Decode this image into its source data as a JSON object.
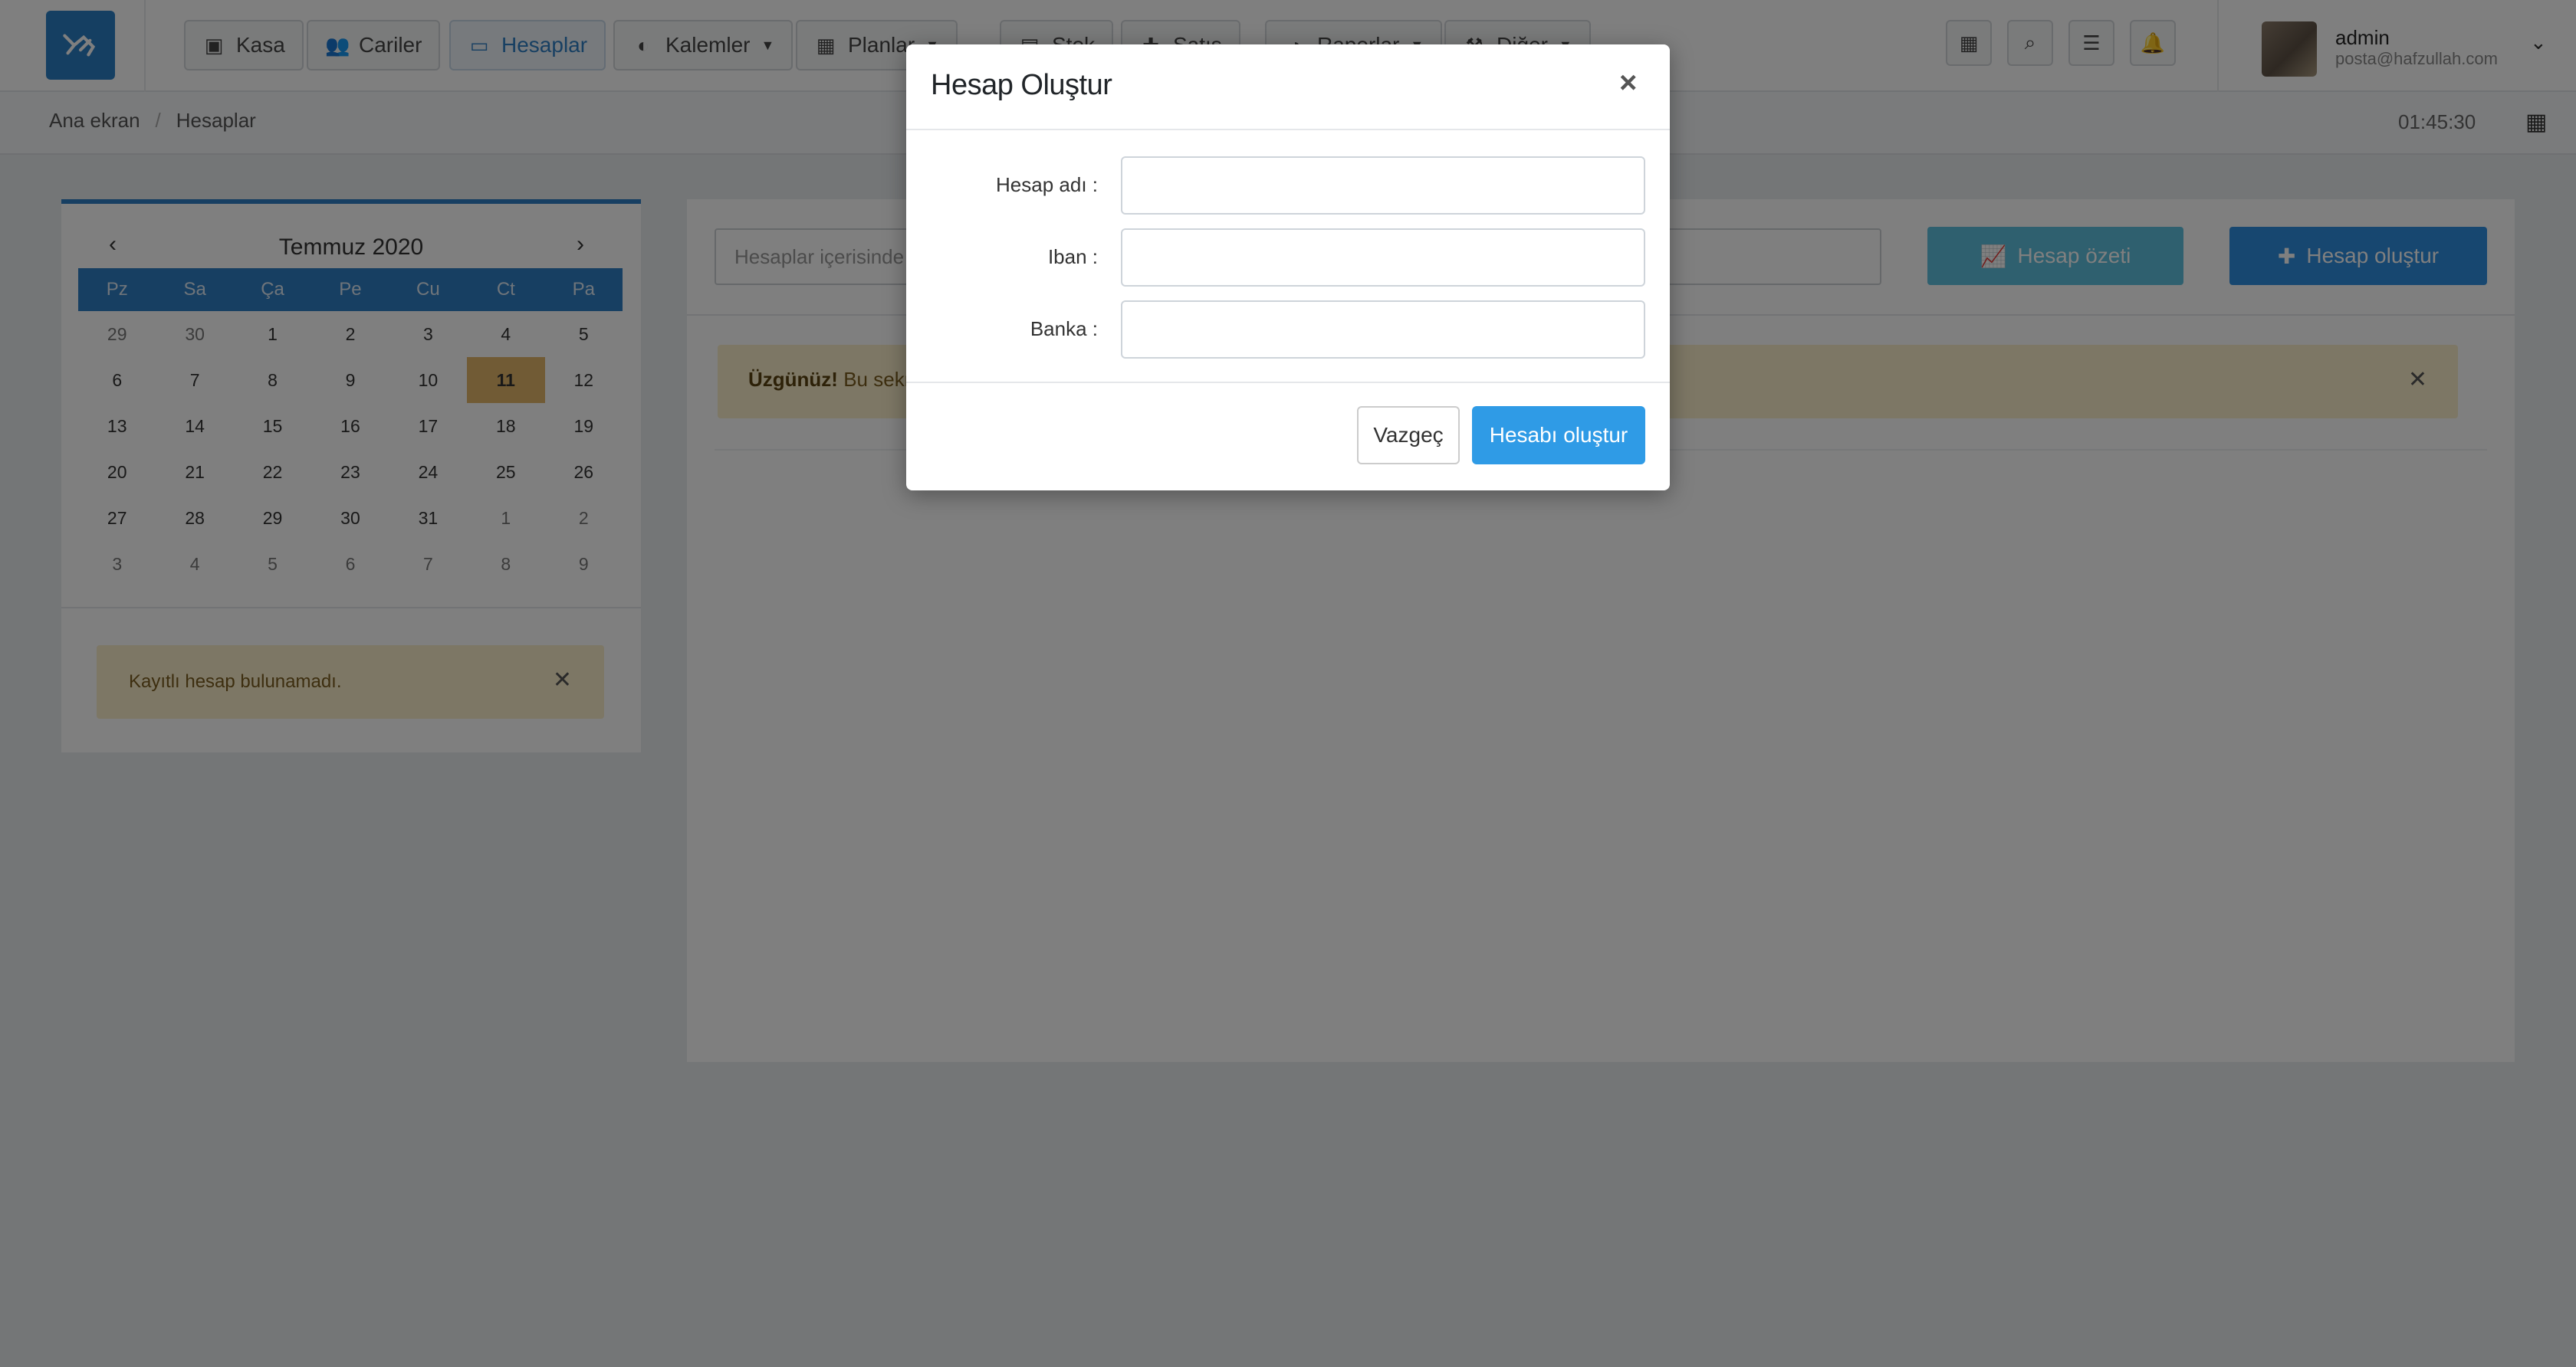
{
  "nav": {
    "items": [
      {
        "label": "Kasa",
        "icon": "cash-register-icon"
      },
      {
        "label": "Cariler",
        "icon": "users-icon"
      },
      {
        "label": "Hesaplar",
        "icon": "credit-card-icon",
        "active": true
      },
      {
        "label": "Kalemler",
        "icon": "pie-icon"
      },
      {
        "label": "Planlar",
        "icon": "calendar-icon"
      },
      {
        "label": "Stok",
        "icon": "database-icon"
      },
      {
        "label": "Satış",
        "icon": "gift-icon"
      },
      {
        "label": "Raporlar",
        "icon": "chart-pie-icon"
      },
      {
        "label": "Diğer",
        "icon": "tools-icon"
      }
    ],
    "tools": [
      "calculator-icon",
      "search-icon",
      "tasks-icon",
      "bell-icon"
    ]
  },
  "user": {
    "name": "admin",
    "email": "posta@hafzullah.com"
  },
  "breadcrumb": {
    "home": "Ana ekran",
    "current": "Hesaplar"
  },
  "clock": "01:45:30",
  "calendar": {
    "title": "Temmuz 2020",
    "weekdays": [
      "Pz",
      "Sa",
      "Ça",
      "Pe",
      "Cu",
      "Ct",
      "Pa"
    ],
    "weeks": [
      [
        "29",
        "30",
        "1",
        "2",
        "3",
        "4",
        "5"
      ],
      [
        "6",
        "7",
        "8",
        "9",
        "10",
        "11",
        "12"
      ],
      [
        "13",
        "14",
        "15",
        "16",
        "17",
        "18",
        "19"
      ],
      [
        "20",
        "21",
        "22",
        "23",
        "24",
        "25",
        "26"
      ],
      [
        "27",
        "28",
        "29",
        "30",
        "31",
        "1",
        "2"
      ],
      [
        "3",
        "4",
        "5",
        "6",
        "7",
        "8",
        "9"
      ]
    ],
    "today": "11",
    "alert": "Kayıtlı hesap bulunamadı."
  },
  "main": {
    "search_placeholder": "Hesaplar içerisinde",
    "summary_button": "Hesap özeti",
    "create_button": "Hesap oluştur",
    "alert_bold": "Üzgünüz!",
    "alert_text": "Bu sekm"
  },
  "modal": {
    "title": "Hesap Oluştur",
    "close": "×",
    "fields": [
      {
        "label": "Hesap adı :",
        "value": ""
      },
      {
        "label": "Iban :",
        "value": ""
      },
      {
        "label": "Banka :",
        "value": ""
      }
    ],
    "cancel": "Vazgeç",
    "submit": "Hesabı oluştur"
  },
  "colors": {
    "primary": "#2f7fc4",
    "info": "#5fc0de",
    "warning_bg": "#fbeecb",
    "today": "#e3b76a"
  }
}
